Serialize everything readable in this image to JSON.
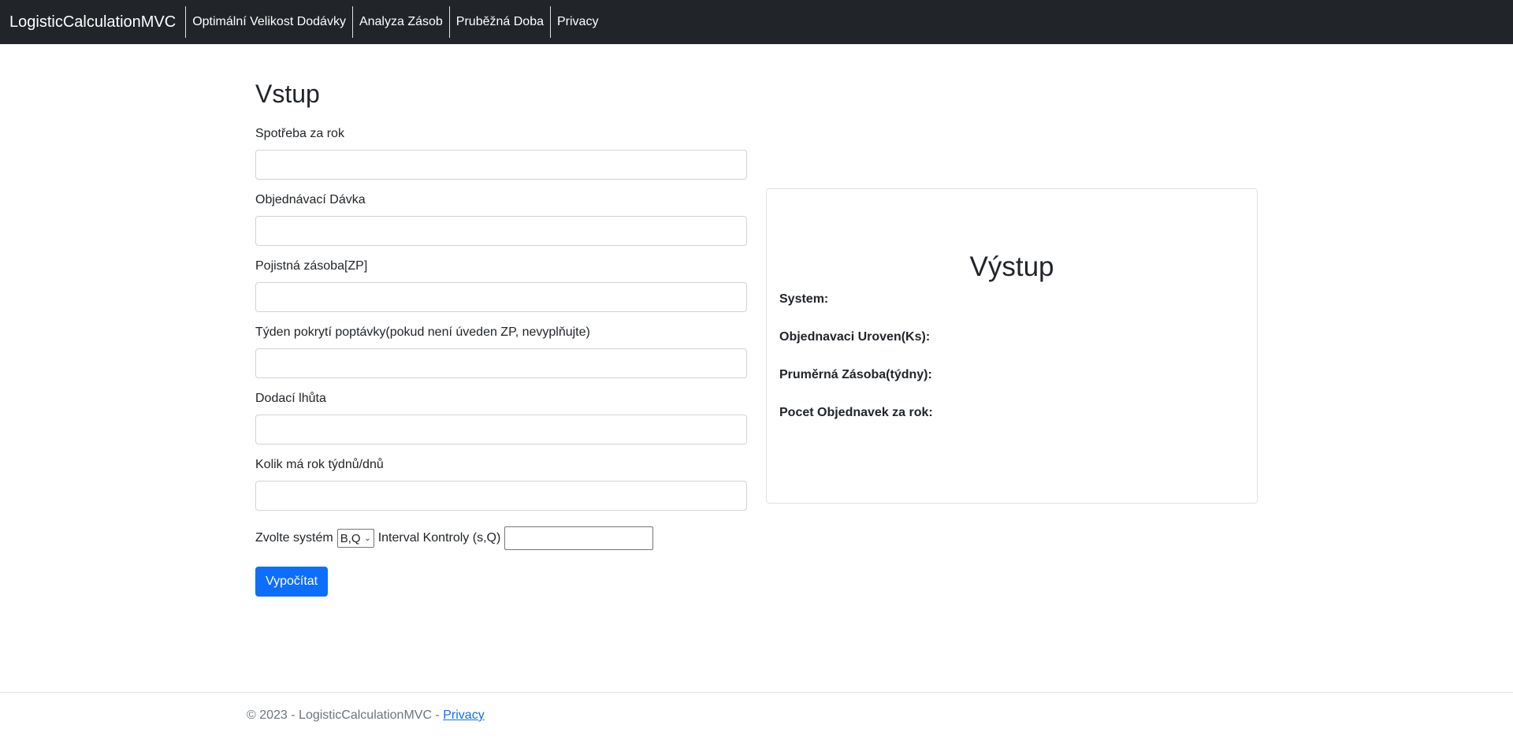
{
  "navbar": {
    "brand": "LogisticCalculationMVC",
    "links": [
      "Optimální Velikost Dodávky",
      "Analyza Zásob",
      "Pruběžná Doba",
      "Privacy"
    ]
  },
  "input": {
    "title": "Vstup",
    "fields": [
      {
        "label": "Spotřeba za rok",
        "value": ""
      },
      {
        "label": "Objednávací Dávka",
        "value": ""
      },
      {
        "label": "Pojistná zásoba[ZP]",
        "value": ""
      },
      {
        "label": "Týden pokrytí poptávky(pokud není úveden ZP, nevyplňujte)",
        "value": ""
      },
      {
        "label": "Dodací lhůta",
        "value": ""
      },
      {
        "label": "Kolik má rok týdnů/dnů",
        "value": ""
      }
    ],
    "system_label": "Zvolte systém",
    "system_selected": "B,Q",
    "interval_label": "Interval Kontroly (s,Q)",
    "interval_value": "",
    "submit_label": "Vypočítat"
  },
  "output": {
    "title": "Výstup",
    "system_label": "System:",
    "order_level_label": "Objednavaci Uroven(Ks):",
    "avg_stock_label": "Pruměrná Zásoba(týdny):",
    "orders_per_year_label": "Pocet Objednavek za rok:"
  },
  "footer": {
    "text": "© 2023 - LogisticCalculationMVC - ",
    "privacy_link": "Privacy"
  },
  "colors": {
    "navbar_bg": "#212529",
    "primary": "#0d6efd",
    "border": "#dee2e6"
  },
  "icons": {
    "select_chevron": "chevron-down-icon"
  }
}
